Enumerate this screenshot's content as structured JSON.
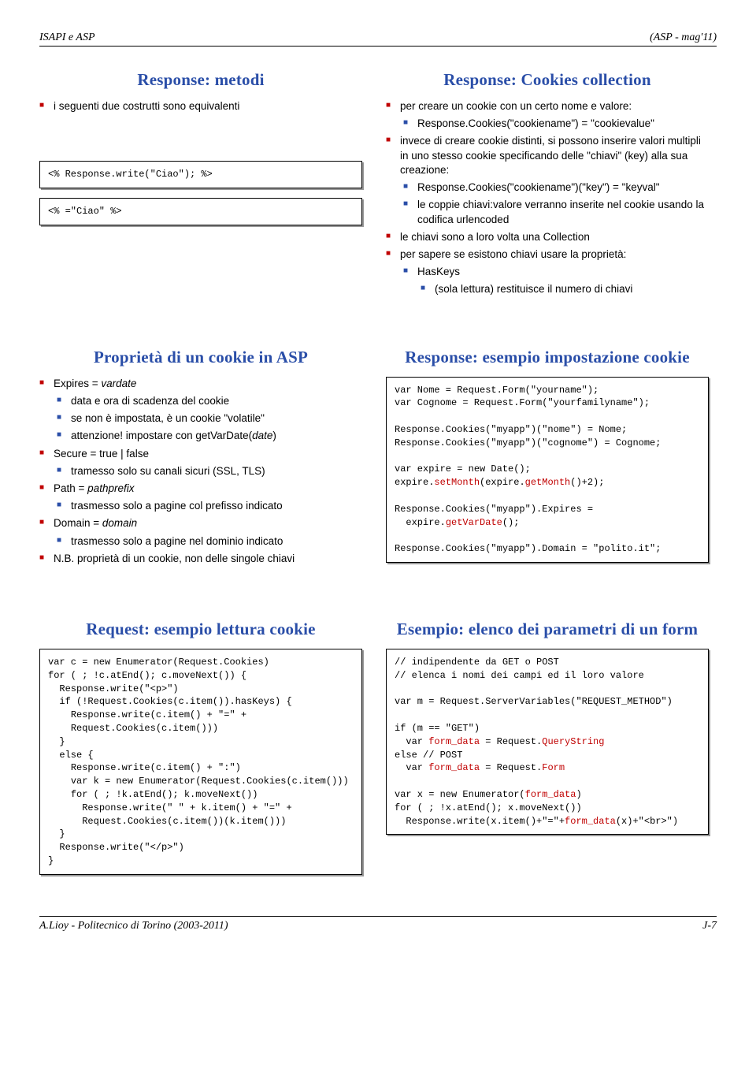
{
  "header": {
    "left": "ISAPI e ASP",
    "right": "(ASP - mag'11)"
  },
  "footer": {
    "left": "A.Lioy - Politecnico di Torino (2003-2011)",
    "right": "J-7"
  },
  "slide1": {
    "title": "Response: metodi",
    "b1": "i seguenti due costrutti sono equivalenti",
    "code1": "<% Response.write(\"Ciao\"); %>",
    "code2": "<% =\"Ciao\" %>"
  },
  "slide2": {
    "title": "Response: Cookies collection",
    "b1": "per creare un cookie con un certo nome e valore:",
    "b1a": "Response.Cookies(\"cookiename\") = \"cookievalue\"",
    "b2": "invece di creare cookie distinti, si possono inserire valori multipli in uno stesso cookie specificando delle \"chiavi\" (key) alla sua creazione:",
    "b2a": "Response.Cookies(\"cookiename\")(\"key\") = \"keyval\"",
    "b2b": "le coppie chiavi:valore verranno inserite nel cookie usando la codifica urlencoded",
    "b3": "le chiavi sono a loro volta una Collection",
    "b4": "per sapere se esistono chiavi usare la proprietà:",
    "b4a": "HasKeys",
    "b4a1": "(sola lettura) restituisce il numero di chiavi"
  },
  "slide3": {
    "title": "Proprietà di un cookie in ASP",
    "b1": "Expires = vardate",
    "b1a": "data e ora di scadenza del cookie",
    "b1b": "se non è impostata, è un cookie \"volatile\"",
    "b1c": "attenzione! impostare con getVarDate(date)",
    "b2": "Secure = true | false",
    "b2a": "tramesso solo su canali sicuri (SSL, TLS)",
    "b3": "Path = pathprefix",
    "b3a": "trasmesso solo a pagine col prefisso indicato",
    "b4": "Domain = domain",
    "b4a": "trasmesso solo a pagine nel dominio indicato",
    "b5": "N.B. proprietà di un cookie, non delle singole chiavi"
  },
  "slide4": {
    "title": "Response: esempio impostazione cookie",
    "code": "var Nome = Request.Form(\"yourname\");\nvar Cognome = Request.Form(\"yourfamilyname\");\n\nResponse.Cookies(\"myapp\")(\"nome\") = Nome;\nResponse.Cookies(\"myapp\")(\"cognome\") = Cognome;\n\nvar expire = new Date();\nexpire.setMonth(expire.getMonth()+2);\n\nResponse.Cookies(\"myapp\").Expires =\n  expire.getVarDate();\n\nResponse.Cookies(\"myapp\").Domain = \"polito.it\";",
    "red1": "setMonth",
    "red2": "getMonth",
    "red3": "getVarDate"
  },
  "slide5": {
    "title": "Request: esempio lettura cookie",
    "code": "var c = new Enumerator(Request.Cookies)\nfor ( ; !c.atEnd(); c.moveNext()) {\n  Response.write(\"<p>\")\n  if (!Request.Cookies(c.item()).hasKeys) {\n    Response.write(c.item() + \"=\" +\n    Request.Cookies(c.item()))\n  }\n  else {\n    Response.write(c.item() + \":\")\n    var k = new Enumerator(Request.Cookies(c.item()))\n    for ( ; !k.atEnd(); k.moveNext())\n      Response.write(\" \" + k.item() + \"=\" +\n      Request.Cookies(c.item())(k.item()))\n  }\n  Response.write(\"</p>\")\n}"
  },
  "slide6": {
    "title": "Esempio: elenco dei parametri di un form",
    "code": "// indipendente da GET o POST\n// elenca i nomi dei campi ed il loro valore\n\nvar m = Request.ServerVariables(\"REQUEST_METHOD\")\n\nif (m == \"GET\")\n  var form_data = Request.QueryString\nelse // POST\n  var form_data = Request.Form\n\nvar x = new Enumerator(form_data)\nfor ( ; !x.atEnd(); x.moveNext())\n  Response.write(x.item()+\"=\"+form_data(x)+\"<br>\")",
    "red1": "form_data",
    "red2": "QueryString",
    "red3": "form_data",
    "red4": "Form",
    "red5": "form_data",
    "red6": "form_data"
  }
}
